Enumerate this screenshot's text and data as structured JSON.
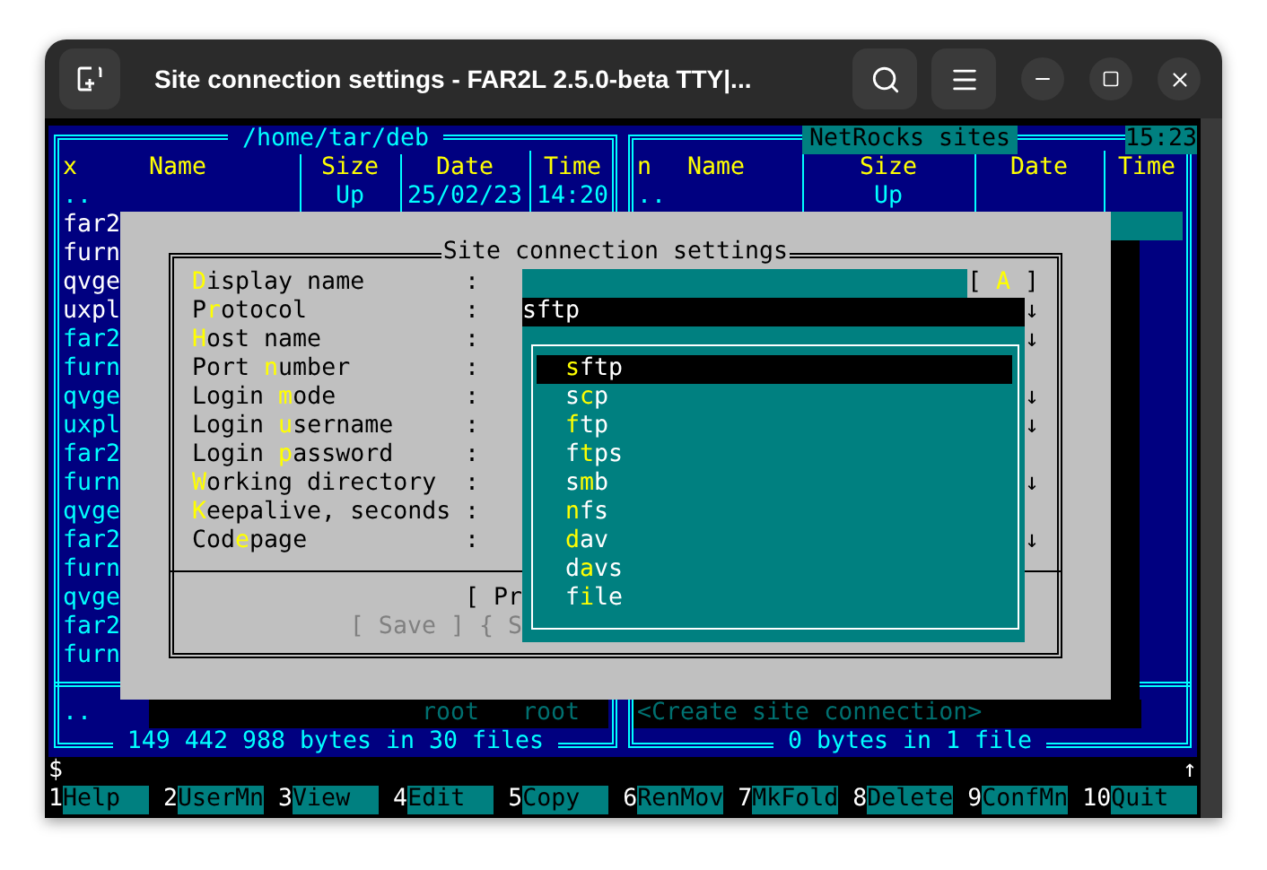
{
  "window": {
    "title": "Site connection settings - FAR2L 2.5.0-beta TTY|..."
  },
  "panels": [
    {
      "title": "/home/tar/deb",
      "active": false,
      "columns": [
        {
          "label": "x"
        },
        {
          "label": "Name"
        },
        {
          "label": "Size"
        },
        {
          "label": "Date"
        },
        {
          "label": "Time"
        }
      ],
      "updir": {
        "name": "..",
        "size": "Up",
        "date": "25/02/23",
        "time": "14:20"
      },
      "files": [
        {
          "name": "far2",
          "kind": "folder"
        },
        {
          "name": "furn",
          "kind": "folder"
        },
        {
          "name": "qvge",
          "kind": "folder"
        },
        {
          "name": "uxpl",
          "kind": "folder"
        },
        {
          "name": "far2",
          "kind": "file"
        },
        {
          "name": "furn",
          "kind": "file"
        },
        {
          "name": "qvge",
          "kind": "file"
        },
        {
          "name": "uxpl",
          "kind": "file"
        },
        {
          "name": "far2",
          "kind": "file"
        },
        {
          "name": "furn",
          "kind": "file"
        },
        {
          "name": "qvge",
          "kind": "file"
        },
        {
          "name": "far2",
          "kind": "file"
        },
        {
          "name": "furn",
          "kind": "file"
        },
        {
          "name": "qvge",
          "kind": "file"
        },
        {
          "name": "far2",
          "kind": "file"
        },
        {
          "name": "furn",
          "kind": "file"
        }
      ],
      "info": {
        "name": "..",
        "owner": "root",
        "group": "root"
      },
      "status": "149 442 988 bytes in 30 files"
    },
    {
      "title": "NetRocks sites",
      "active": true,
      "columns": [
        {
          "label": "n"
        },
        {
          "label": "Name"
        },
        {
          "label": "Size"
        },
        {
          "label": "Date"
        },
        {
          "label": "Time"
        }
      ],
      "updir": {
        "name": "..",
        "size": "Up"
      },
      "info": {
        "name": "<Create site connection>"
      },
      "status": "0 bytes in 1 file"
    }
  ],
  "clock": "15:23",
  "dialog": {
    "title": "Site connection settings",
    "fields": [
      {
        "label": {
          "key": "D",
          "post": "isplay name"
        },
        "separator": ":",
        "input": {
          "focused": false
        },
        "suffix": {
          "pre": "[ ",
          "key": "A",
          "post": " ]"
        }
      },
      {
        "label": {
          "pre": "P",
          "key": "r",
          "post": "otocol"
        },
        "separator": ":",
        "input": {
          "focused": true,
          "value": "sftp"
        },
        "arrow": "↓"
      },
      {
        "label": {
          "key": "H",
          "post": "ost name"
        },
        "separator": ":",
        "arrow": "↓"
      },
      {
        "label": {
          "pre": "Port ",
          "key": "n",
          "post": "umber"
        },
        "separator": ":"
      },
      {
        "label": {
          "pre": "Login ",
          "key": "m",
          "post": "ode"
        },
        "separator": ":",
        "arrow": "↓"
      },
      {
        "label": {
          "pre": "Login ",
          "key": "u",
          "post": "sername"
        },
        "separator": ":",
        "arrow": "↓"
      },
      {
        "label": {
          "pre": "Login ",
          "key": "p",
          "post": "assword"
        },
        "separator": ":"
      },
      {
        "label": {
          "key": "W",
          "post": "orking directory"
        },
        "separator": ":",
        "arrow": "↓"
      },
      {
        "label": {
          "key": "K",
          "post": "eepalive, seconds"
        },
        "separator": ":"
      },
      {
        "label": {
          "pre": "Cod",
          "key": "e",
          "post": "page"
        },
        "separator": ":",
        "arrow": "↓"
      }
    ],
    "button_rows": [
      {
        "buttons": [
          {
            "text": "[ Pr",
            "disabled": false
          }
        ]
      },
      {
        "buttons": [
          {
            "text": "[ Save ]",
            "disabled": true
          },
          {
            "text": "{ S",
            "disabled": true
          }
        ]
      }
    ],
    "dropdown": [
      {
        "key": "s",
        "post": "ftp",
        "selected": true
      },
      {
        "pre": "s",
        "key": "c",
        "post": "p",
        "selected": false
      },
      {
        "key": "f",
        "post": "tp",
        "selected": false
      },
      {
        "pre": "f",
        "key": "t",
        "post": "ps",
        "selected": false
      },
      {
        "pre": "s",
        "key": "m",
        "post": "b",
        "selected": false
      },
      {
        "key": "n",
        "post": "fs",
        "selected": false
      },
      {
        "key": "d",
        "post": "av",
        "selected": false
      },
      {
        "pre": "d",
        "key": "a",
        "post": "vs",
        "selected": false
      },
      {
        "pre": "f",
        "key": "i",
        "post": "le",
        "selected": false
      }
    ]
  },
  "command_line": {
    "prompt": "$",
    "scroll_indicator": "↑"
  },
  "keybar": [
    {
      "number": "1",
      "label": "Help"
    },
    {
      "number": "2",
      "label": "UserMn"
    },
    {
      "number": "3",
      "label": "View"
    },
    {
      "number": "4",
      "label": "Edit"
    },
    {
      "number": "5",
      "label": "Copy"
    },
    {
      "number": "6",
      "label": "RenMov"
    },
    {
      "number": "7",
      "label": "MkFold"
    },
    {
      "number": "8",
      "label": "Delete"
    },
    {
      "number": "9",
      "label": "ConfMn"
    },
    {
      "number": "10",
      "label": "Quit"
    }
  ]
}
